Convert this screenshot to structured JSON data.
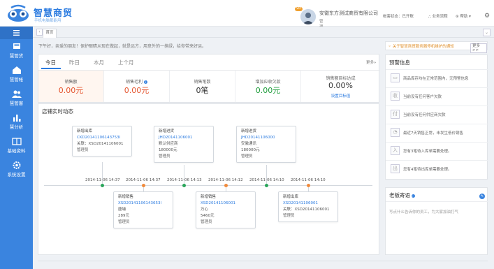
{
  "brand": {
    "title": "智慧商贸",
    "subtitle": "手机电脑都能用",
    "accent": "#2b7be0"
  },
  "header": {
    "vip_badge": "VIP",
    "company_name": "安徽东方测试商贸有限公司",
    "user_role": "管理员",
    "account_status": "帐套状态：已开账",
    "business_flow": "业务流程",
    "help": "帮助",
    "icons": [
      "avatar",
      "flow-icon",
      "help-icon",
      "gear-icon"
    ]
  },
  "sidebar": {
    "color": "#3a84df",
    "items": [
      {
        "label": "慧管货",
        "icon": "cart-icon"
      },
      {
        "label": "慧管帐",
        "icon": "wallet-icon"
      },
      {
        "label": "慧管客",
        "icon": "users-icon"
      },
      {
        "label": "慧分析",
        "icon": "chart-icon"
      },
      {
        "label": "基础资料",
        "icon": "book-icon"
      },
      {
        "label": "系统设置",
        "icon": "gear-icon"
      }
    ]
  },
  "tabs": {
    "home": "首页"
  },
  "greeting": "下午好，亲爱的朋友！保护眼睛从现在做起，就是远方，用意外的一抹绿，给你带来好运。",
  "stats": {
    "period_tabs": [
      "今日",
      "昨日",
      "本月",
      "上个月"
    ],
    "more": "更多»",
    "items": [
      {
        "label": "销售额",
        "value": "0.00元"
      },
      {
        "label": "销售毛利",
        "value": "0.00元"
      },
      {
        "label": "销售笔数",
        "value": "0笔"
      },
      {
        "label": "增加应收欠款",
        "value": "0.00元"
      },
      {
        "label": "销售额目标达成",
        "value": "0.00%",
        "link": "设置目标值"
      }
    ]
  },
  "dynamics": {
    "title": "店铺实时动态",
    "top_cards": [
      {
        "type": "新增出库",
        "code": "CKD20141106143753l",
        "meta": "关联：XSD20141106001",
        "operator": "管理员",
        "time": "2014-11-06 14:37"
      },
      {
        "type": "新增进货",
        "code": "JHD20141106001",
        "meta": "默认供应商",
        "amount": "180000元",
        "operator": "管理员",
        "time": "2014-11-06 14:13"
      },
      {
        "type": "新增进货",
        "code": "JHD20141106000",
        "meta": "安徽通讯",
        "amount": "180000元",
        "operator": "管理员",
        "time": "2014-11-06 14:10"
      }
    ],
    "bottom_cards": [
      {
        "type": "新增销售",
        "code": "XSD20141106143653l",
        "meta": "唐埔",
        "amount": "289元",
        "operator": "管理员",
        "time": "2014-11-06 14:37"
      },
      {
        "type": "新增销售",
        "code": "XSD20141106001",
        "meta": "万心",
        "amount": "5460元",
        "operator": "管理员",
        "time": "2014-11-06 14:12"
      },
      {
        "type": "新增出库",
        "code": "XSD20141106001",
        "meta": "关联：XSD20141106001",
        "operator": "管理员",
        "time": "2014-11-06 14:10"
      }
    ]
  },
  "warning_bar": {
    "text": "关于智慧商贸服务器停机维护的通知",
    "more": "更多>>"
  },
  "alerts": {
    "title": "预警信息",
    "items": [
      {
        "icon": "box-icon",
        "glyph": "▭",
        "text": "商品库存均在正常范围内，无预警信息"
      },
      {
        "icon": "receivable-icon",
        "glyph": "收",
        "text": "当前没有任何客户欠款"
      },
      {
        "icon": "payable-icon",
        "glyph": "付",
        "text": "当前没有任何供应商欠款"
      },
      {
        "icon": "sales-icon",
        "glyph": "◔",
        "text": "最近7天销售正常，未发生低价销售"
      },
      {
        "icon": "inbound-icon",
        "glyph": "入",
        "text": "您有3笔待入库单需要处理。"
      },
      {
        "icon": "outbound-icon",
        "glyph": "出",
        "text": "您有4笔待出库单需要处理。"
      }
    ]
  },
  "boss_message": {
    "title": "老板寄语",
    "placeholder": "写点什么告诉你的员工，为大家加油打气"
  }
}
